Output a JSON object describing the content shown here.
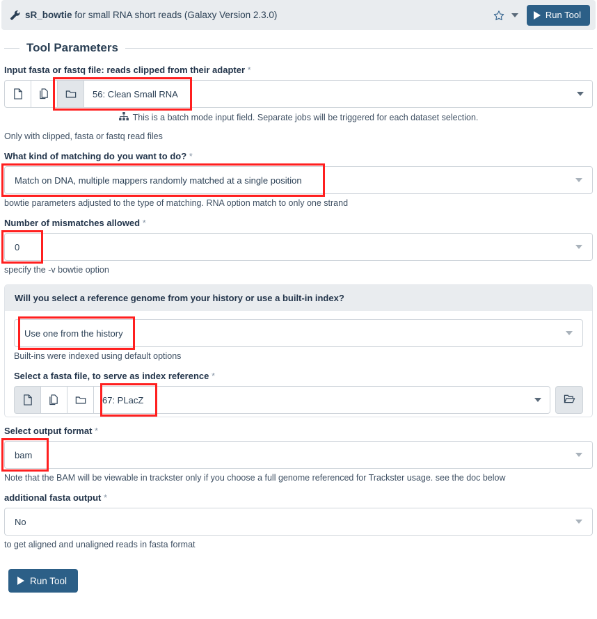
{
  "header": {
    "wrench_icon": "wrench-icon",
    "tool_name": "sR_bowtie",
    "tool_subtitle": "for small RNA short reads (Galaxy Version 2.3.0)",
    "star_icon": "star-outline-icon",
    "caret_icon": "chevron-down-icon",
    "run_label": "Run Tool"
  },
  "section": {
    "legend": "Tool Parameters"
  },
  "fields": {
    "input_reads": {
      "label": "Input fasta or fastq file: reads clipped from their adapter",
      "required": "*",
      "icons": [
        "single-dataset-icon",
        "multiple-datasets-icon",
        "dataset-collection-icon"
      ],
      "active_icon_index": 2,
      "value": "56: Clean Small RNA",
      "batch_note": "This is a batch mode input field. Separate jobs will be triggered for each dataset selection.",
      "batch_icon": "sitemap-icon",
      "help": "Only with clipped, fasta or fastq read files"
    },
    "matching": {
      "label": "What kind of matching do you want to do?",
      "required": "*",
      "value": "Match on DNA, multiple mappers randomly matched at a single position",
      "help": "bowtie parameters adjusted to the type of matching. RNA option match to only one strand"
    },
    "mismatches": {
      "label": "Number of mismatches allowed",
      "required": "*",
      "value": "0",
      "help": "specify the -v bowtie option"
    },
    "reference_panel": {
      "title": "Will you select a reference genome from your history or use a built-in index?",
      "value": "Use one from the history",
      "help": "Built-ins were indexed using default options"
    },
    "index_fasta": {
      "label": "Select a fasta file, to serve as index reference",
      "required": "*",
      "icons": [
        "single-dataset-icon",
        "multiple-datasets-icon",
        "dataset-collection-icon"
      ],
      "active_icon_index": 0,
      "value": "67: PLacZ",
      "browse_icon": "folder-open-icon"
    },
    "output_format": {
      "label": "Select output format",
      "required": "*",
      "value": "bam",
      "help": "Note that the BAM will be viewable in trackster only if you choose a full genome referenced for Trackster usage. see the doc below"
    },
    "additional_fasta": {
      "label": "additional fasta output",
      "required": "*",
      "value": "No",
      "help": "to get aligned and unaligned reads in fasta format"
    }
  },
  "footer": {
    "run_label": "Run Tool"
  },
  "colors": {
    "accent": "#2c5f87",
    "header_bg": "#e9ecef",
    "annotation": "#ff1f1f",
    "text": "#2a3f54"
  }
}
